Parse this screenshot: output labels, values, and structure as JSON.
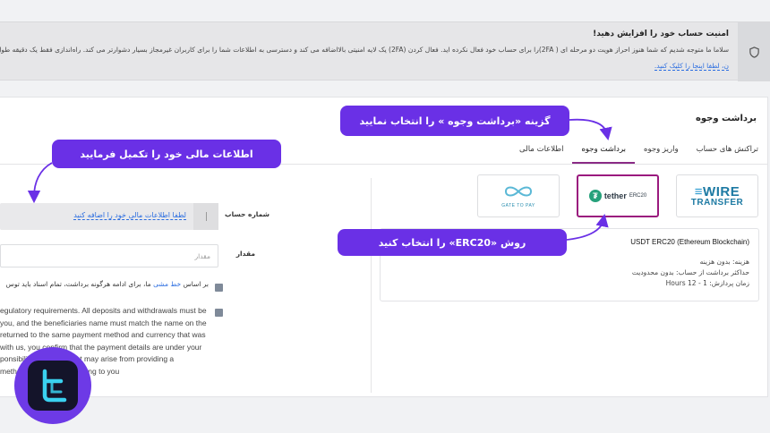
{
  "alert": {
    "title": "امنیت حساب خود را افزایش دهید!",
    "body": "سلاما ما متوجه شدیم که شما هنوز احراز هویت دو مرحله ای ( 2FA)را برای حساب خود فعال نکرده اید. فعال کردن (2FA) یک لایه امنیتی بالااضافه می کند و دسترسی به اطلاعات شما را برای کاربران غیرمجاز بسیار دشوارتر می کند. راه‌اندازی فقط یک دقیقه طول می‌کشد، اما می‌تواند ت",
    "link": "ن، لطفا اینجا را کلیک کنید."
  },
  "page": {
    "title": "برداشت وجوه",
    "tabs": [
      "تراکنش های حساب",
      "واریز وجوه",
      "برداشت وجوه",
      "اطلاعات مالی"
    ],
    "active_tab": 2
  },
  "methods": {
    "wire": {
      "line1": "WIRE",
      "line2": "TRANSFER"
    },
    "tether": {
      "name": "tether",
      "tag": "ERC20"
    },
    "gate2pay": {
      "label": "GATE TO PAY"
    }
  },
  "selected_method": {
    "title": "USDT ERC20 (Ethereum Blockchain)",
    "fee": "هزینه:  بدون هزینه",
    "max": "حداکثر برداشت از حساب:  بدون محدودیت",
    "time": "زمان پردازش:  1 - 12 Hours"
  },
  "form": {
    "account_label": "شماره حساب",
    "account_link": "لطفا اطلاعات مالی خود را اضافه کنید",
    "amount_label": "مقدار",
    "amount_placeholder": "مقدار",
    "terms1_pre": "بر اساس ",
    "terms1_link": "خط مشی",
    "terms1_post": " ما، برای ادامه هرگونه برداشت، تمام اسناد باید توس",
    "terms2_lines": [
      "egulatory requirements. All deposits and withdrawals must be",
      "you, and the beneficiaries name must match the name on the",
      "returned to the same payment method and currency that was",
      " with us, you confirm that the payment details are under your",
      "ponsibility or liability that may arise from providing a",
      "method that does not belong to you"
    ]
  },
  "annotations": {
    "tab_hint": "گزینه «برداشت وجوه » را انتخاب نمایید",
    "method_hint": "روش «ERC20» را انتخاب کنید",
    "form_hint": "اطلاعات مالی خود را تکمیل فرمایید"
  },
  "colors": {
    "accent": "#6a30e6",
    "selected_border": "#9a1a7e",
    "link": "#2b6de0"
  }
}
